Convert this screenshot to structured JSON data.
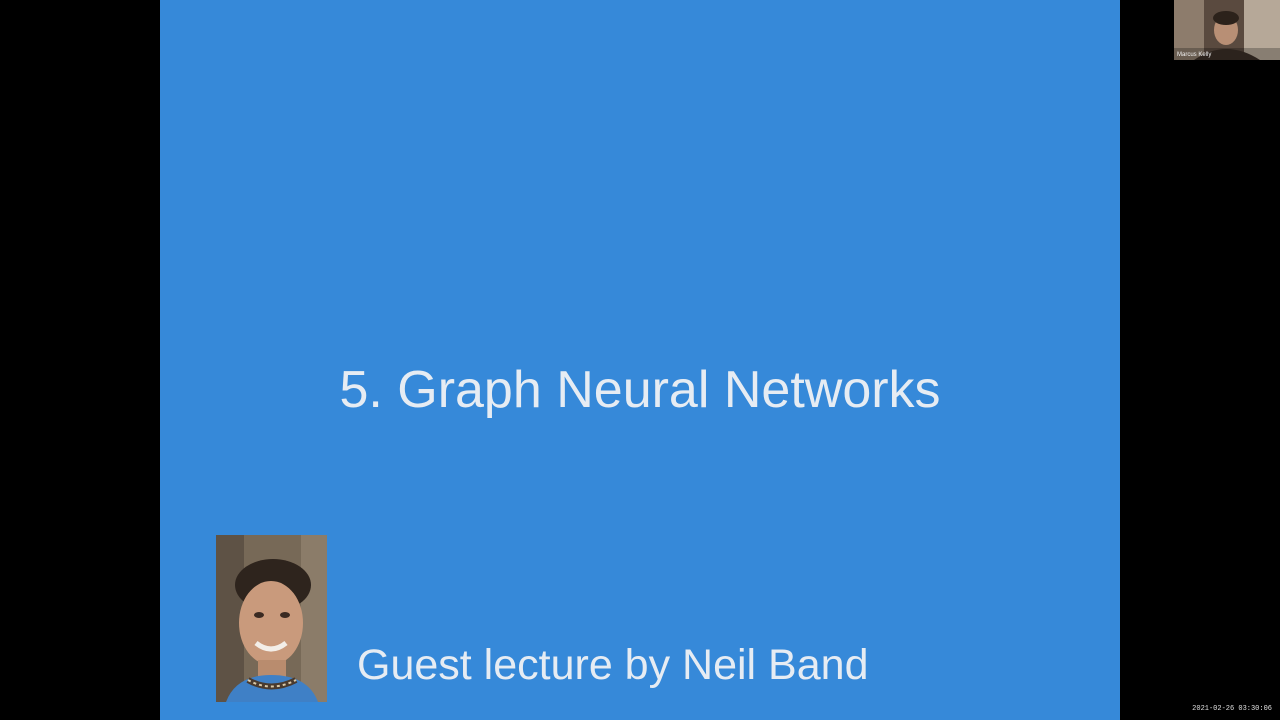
{
  "slide": {
    "title": "5. Graph Neural Networks",
    "subtitle": "Guest lecture by Neil Band",
    "background_color": "#3689d9",
    "text_color": "#e6ecf3"
  },
  "speaker_photo": {
    "description_icon": "person-photo"
  },
  "video_thumbnail": {
    "participant_name": "Marcus Kelly"
  },
  "overlay": {
    "timestamp": "2021-02-26 03:30:06"
  }
}
